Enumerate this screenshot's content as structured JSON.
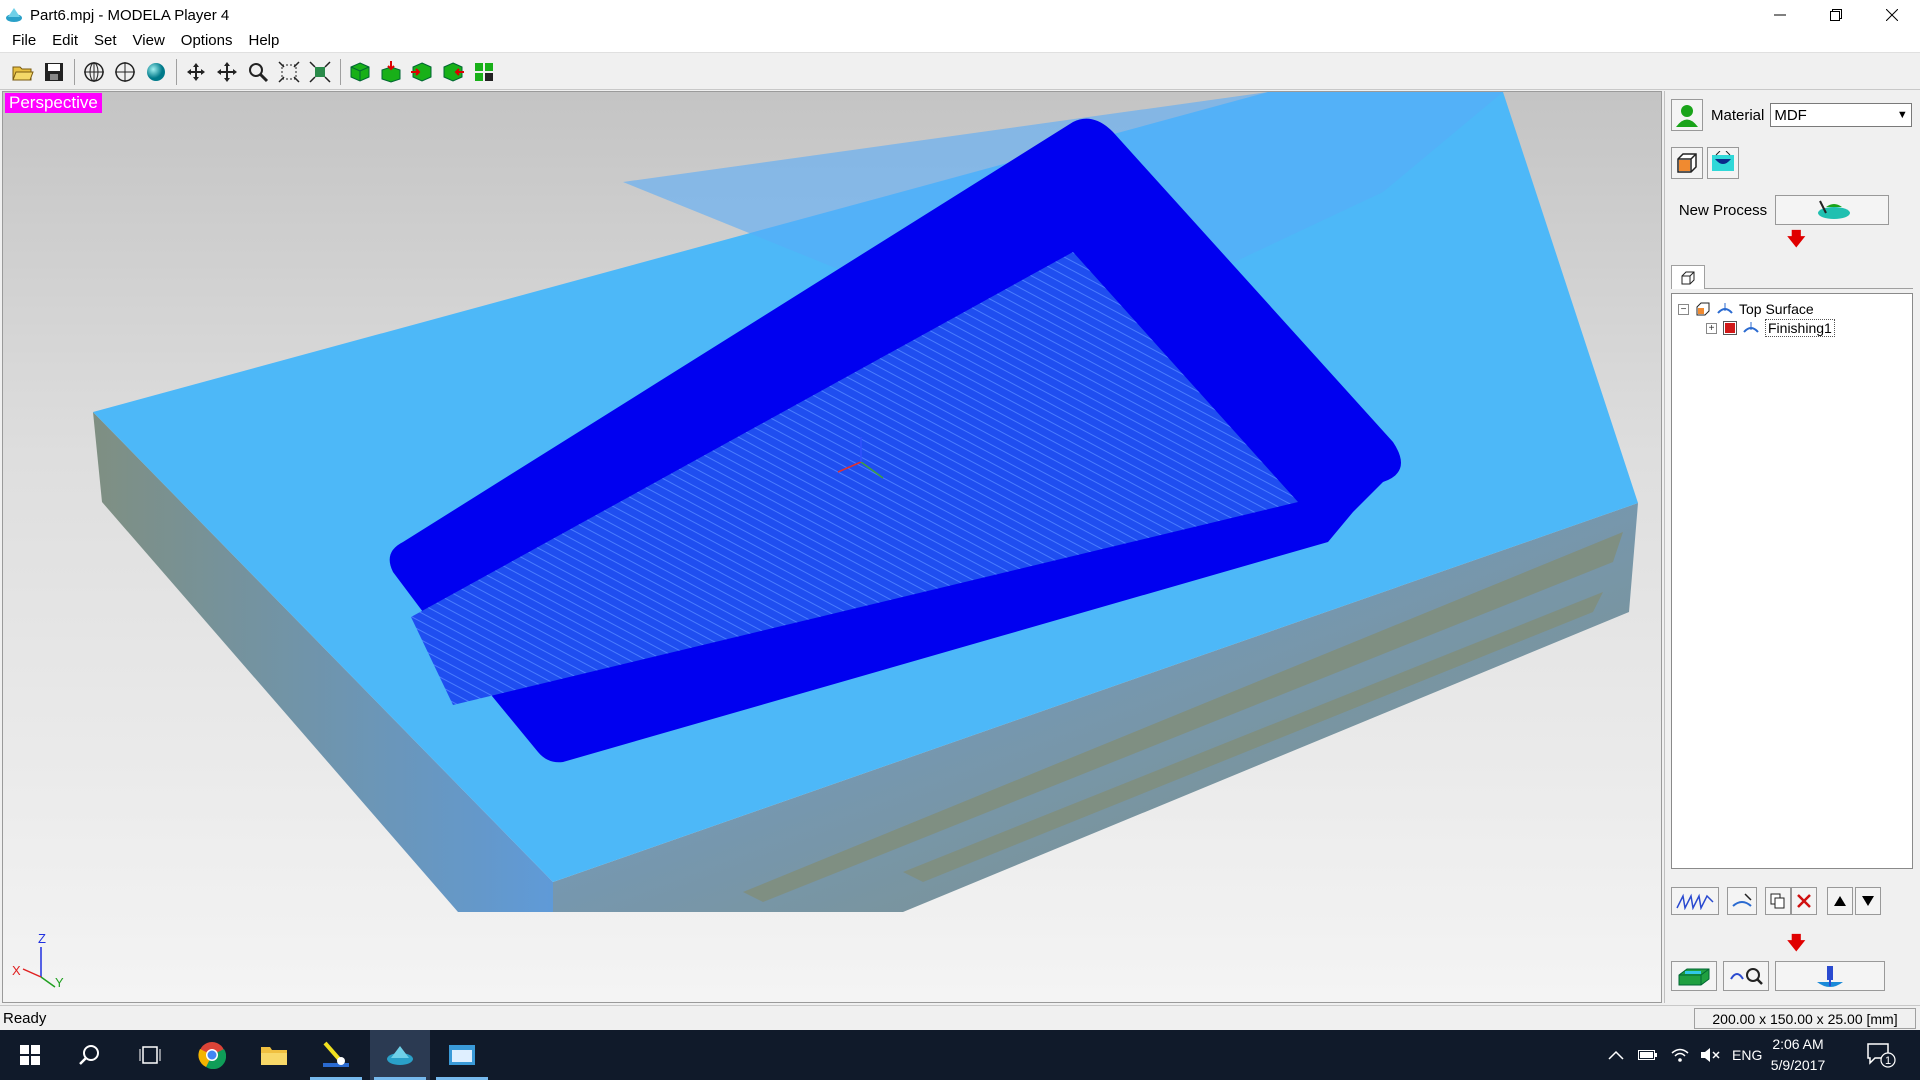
{
  "window": {
    "title": "Part6.mpj - MODELA Player 4"
  },
  "menu": {
    "items": [
      "File",
      "Edit",
      "Set",
      "View",
      "Options",
      "Help"
    ]
  },
  "viewport": {
    "view_label": "Perspective",
    "axes": {
      "z": "Z",
      "x": "X",
      "y": "Y"
    }
  },
  "panel": {
    "material_label": "Material",
    "material_value": "MDF",
    "new_process_label": "New Process",
    "tree": {
      "root_label": "Top Surface",
      "child_label": "Finishing1",
      "root_expander": "−",
      "child_expander": "+"
    }
  },
  "status": {
    "ready": "Ready",
    "dimensions": "200.00 x 150.00 x 25.00 [mm]"
  },
  "taskbar": {
    "language": "ENG",
    "time": "2:06 AM",
    "date": "5/9/2017",
    "notification_count": "1"
  },
  "colors": {
    "stock_top": "#4db8f8",
    "pocket": "#0000f0",
    "side_face": "#7f8f82",
    "view_label_bg": "#ff00ff",
    "taskbar_bg": "#101a2a"
  }
}
